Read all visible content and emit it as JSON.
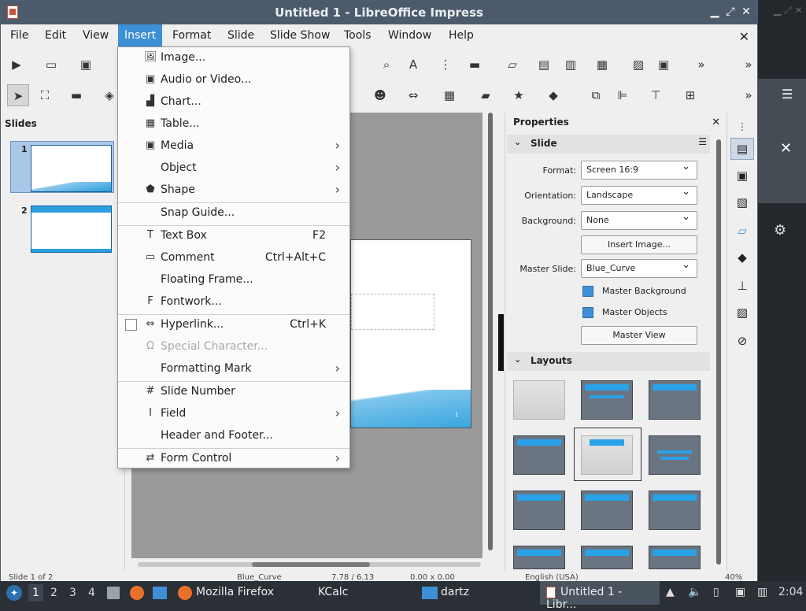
{
  "window": {
    "title": "Untitled 1 - LibreOffice Impress"
  },
  "menubar": {
    "items": [
      "File",
      "Edit",
      "View",
      "Insert",
      "Format",
      "Slide",
      "Slide Show",
      "Tools",
      "Window",
      "Help"
    ],
    "active": "Insert"
  },
  "slides_panel": {
    "header": "Slides",
    "slides": [
      "1",
      "2"
    ]
  },
  "properties": {
    "header": "Properties",
    "slide_section": "Slide",
    "format_label": "Format:",
    "format_value": "Screen 16:9",
    "orientation_label": "Orientation:",
    "orientation_value": "Landscape",
    "background_label": "Background:",
    "background_value": "None",
    "insert_image_button": "Insert Image...",
    "master_slide_label": "Master Slide:",
    "master_slide_value": "Blue_Curve",
    "master_background": "Master Background",
    "master_objects": "Master Objects",
    "master_view_button": "Master View",
    "layouts_section": "Layouts"
  },
  "slide_page_number": "1",
  "insert_menu": {
    "items": [
      {
        "label": "Image...",
        "icon": "image-icon",
        "glyph": "🖼",
        "shortcut": "",
        "submenu": false
      },
      {
        "label": "Audio or Video...",
        "icon": "film-icon",
        "glyph": "▣",
        "shortcut": "",
        "submenu": false
      },
      {
        "label": "Chart...",
        "icon": "chart-icon",
        "glyph": "▟",
        "shortcut": "",
        "submenu": false
      },
      {
        "label": "Table...",
        "icon": "table-icon",
        "glyph": "▦",
        "shortcut": "",
        "submenu": false
      },
      {
        "label": "Media",
        "icon": "media-icon",
        "glyph": "▣",
        "shortcut": "",
        "submenu": true
      },
      {
        "label": "Object",
        "icon": "",
        "glyph": "",
        "shortcut": "",
        "submenu": true
      },
      {
        "label": "Shape",
        "icon": "pentagon-icon",
        "glyph": "⬟",
        "shortcut": "",
        "submenu": true
      },
      {
        "label": "Snap Guide...",
        "icon": "",
        "glyph": "",
        "shortcut": "",
        "submenu": false
      },
      {
        "label": "Text Box",
        "icon": "text-box-icon",
        "glyph": "T",
        "shortcut": "F2",
        "submenu": false
      },
      {
        "label": "Comment",
        "icon": "comment-icon",
        "glyph": "▭",
        "shortcut": "Ctrl+Alt+C",
        "submenu": false
      },
      {
        "label": "Floating Frame...",
        "icon": "",
        "glyph": "",
        "shortcut": "",
        "submenu": false
      },
      {
        "label": "Fontwork...",
        "icon": "fontwork-icon",
        "glyph": "F",
        "shortcut": "",
        "submenu": false
      },
      {
        "label": "Hyperlink...",
        "icon": "hyperlink-icon",
        "glyph": "⇔",
        "shortcut": "Ctrl+K",
        "submenu": false
      },
      {
        "label": "Special Character...",
        "icon": "omega-icon",
        "glyph": "Ω",
        "shortcut": "",
        "submenu": false,
        "disabled": true
      },
      {
        "label": "Formatting Mark",
        "icon": "",
        "glyph": "",
        "shortcut": "",
        "submenu": true
      },
      {
        "label": "Slide Number",
        "icon": "slide-number-icon",
        "glyph": "#",
        "shortcut": "",
        "submenu": false
      },
      {
        "label": "Field",
        "icon": "field-icon",
        "glyph": "I",
        "shortcut": "",
        "submenu": true
      },
      {
        "label": "Header and Footer...",
        "icon": "",
        "glyph": "",
        "shortcut": "",
        "submenu": false
      },
      {
        "label": "Form Control",
        "icon": "form-control-icon",
        "glyph": "⇄",
        "shortcut": "",
        "submenu": true
      }
    ]
  },
  "statusbar": {
    "slide_info": "Slide 1 of 2",
    "master": "Blue_Curve",
    "pos": "7.78 / 6.13",
    "size": "0.00 x 0.00",
    "lang": "English (USA)",
    "zoom": "40%"
  },
  "taskbar": {
    "workspaces": [
      "1",
      "2",
      "3",
      "4"
    ],
    "active_workspace": "1",
    "apps": [
      "Mozilla Firefox",
      "KCalc",
      "dartz",
      "Untitled 1 - Libr..."
    ],
    "clock": "2:04"
  },
  "colors": {
    "accent": "#3d8fd6",
    "titlebar": "#4c5a6c",
    "taskbar": "#2b3036",
    "slide_blue": "#2a9ede"
  }
}
